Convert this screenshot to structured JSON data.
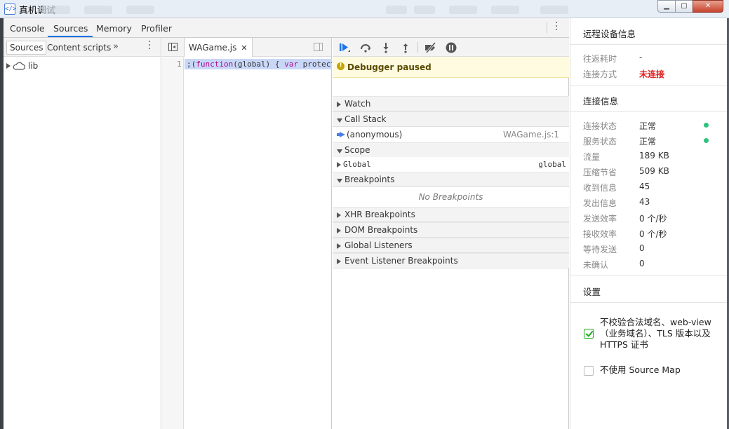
{
  "window": {
    "title": "真机调试",
    "icon": "code-brackets-icon",
    "controls": [
      "minimize",
      "maximize",
      "close"
    ]
  },
  "devtools": {
    "tabs": [
      "Console",
      "Sources",
      "Memory",
      "Profiler"
    ],
    "active_tab": "Sources",
    "navigator": {
      "tabs": [
        "Sources",
        "Content scripts"
      ],
      "active_tab": "Sources",
      "overflow": "»",
      "tree": [
        {
          "icon": "cloud-icon",
          "label": "lib"
        }
      ]
    },
    "editor": {
      "open_file": "WAGame.js",
      "line_number": "1",
      "code": ";(function(global) { var protect"
    },
    "debugger": {
      "paused_message": "Debugger paused",
      "sections": {
        "watch": "Watch",
        "call_stack": "Call Stack",
        "scope": "Scope",
        "breakpoints": "Breakpoints",
        "xhr": "XHR Breakpoints",
        "dom": "DOM Breakpoints",
        "global_listeners": "Global Listeners",
        "event_listeners": "Event Listener Breakpoints"
      },
      "call_stack": [
        {
          "name": "(anonymous)",
          "location": "WAGame.js:1"
        }
      ],
      "scope": [
        {
          "name": "Global",
          "value": "global"
        }
      ],
      "breakpoints_empty": "No Breakpoints"
    }
  },
  "remote_info": {
    "title": "远程设备信息",
    "rows": [
      {
        "label": "往返耗时",
        "value": "-"
      },
      {
        "label": "连接方式",
        "value": "未连接",
        "status": "error",
        "color": "#e02020"
      }
    ]
  },
  "connection_info": {
    "title": "连接信息",
    "rows": [
      {
        "label": "连接状态",
        "value": "正常",
        "dot": true
      },
      {
        "label": "服务状态",
        "value": "正常",
        "dot": true
      },
      {
        "label": "流量",
        "value": "189 KB"
      },
      {
        "label": "压缩节省",
        "value": "509 KB"
      },
      {
        "label": "收到信息",
        "value": "45"
      },
      {
        "label": "发出信息",
        "value": "43"
      },
      {
        "label": "发送效率",
        "value": "0 个/秒"
      },
      {
        "label": "接收效率",
        "value": "0 个/秒"
      },
      {
        "label": "等待发送",
        "value": "0"
      },
      {
        "label": "未确认",
        "value": "0"
      }
    ],
    "status_color": "#2ec27e"
  },
  "settings": {
    "title": "设置",
    "options": [
      {
        "label": "不校验合法域名、web-view（业务域名）、TLS 版本以及 HTTPS 证书",
        "checked": true
      },
      {
        "label": "不使用 Source Map",
        "checked": false
      }
    ]
  },
  "colors": {
    "accent": "#1a73e8",
    "paused_bg": "#fffbe0",
    "highlight_line": "#c9d7f7"
  }
}
